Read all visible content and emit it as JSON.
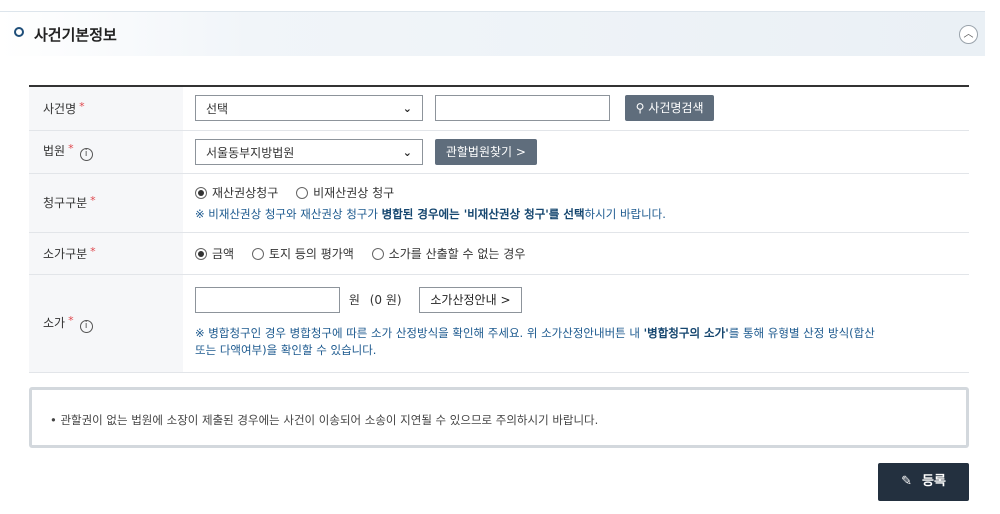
{
  "section": {
    "title": "사건기본정보",
    "collapse_icon": "chevron-up-icon",
    "collapse_glyph": "︿"
  },
  "rows": {
    "case_name": {
      "label": "사건명",
      "required": "*",
      "select_value": "선택",
      "input_value": "",
      "search_button": "사건명검색"
    },
    "court": {
      "label": "법원",
      "required": "*",
      "select_value": "서울동부지방법원",
      "find_button": "관할법원찾기 >"
    },
    "claim_type": {
      "label": "청구구분",
      "required": "*",
      "options": [
        "재산권상청구",
        "비재산권상 청구"
      ],
      "selected": 0,
      "note_prefix": "※ 비재산권상 청구와 재산권상 청구가 ",
      "note_bold1": "병합된 경우에는 '비재산권상 청구'를 선택",
      "note_suffix": "하시기 바랍니다."
    },
    "value_type": {
      "label": "소가구분",
      "required": "*",
      "options": [
        "금액",
        "토지 등의 평가액",
        "소가를 산출할 수 없는 경우"
      ],
      "selected": 0
    },
    "value": {
      "label": "소가",
      "required": "*",
      "input_value": "",
      "unit": "원",
      "amount_display": "(0 원)",
      "guide_button": "소가산정안내 >",
      "note_part1": "※ 병합청구인 경우 병합청구에 따른 소가 산정방식을 확인해 주세요.  위 소가산정안내버튼 내 ",
      "note_bold": "'병합청구의 소가'",
      "note_part2": "를 통해 유형별 산정 방식(합산",
      "note_line2": "또는 다액여부)을 확인할 수 있습니다."
    }
  },
  "notice": "• 관할권이 없는 법원에 소장이 제출된 경우에는 사건이 이송되어 소송이 지연될 수 있으므로 주의하시기 바랍니다.",
  "register_button": "등록",
  "icons": {
    "info": "i",
    "pen": "✎",
    "search": "⚲"
  },
  "colors": {
    "accent_dark": "#23303f",
    "button_gray": "#5f6d7c",
    "note_blue": "#1d5a8f",
    "required_red": "#e0484e"
  }
}
